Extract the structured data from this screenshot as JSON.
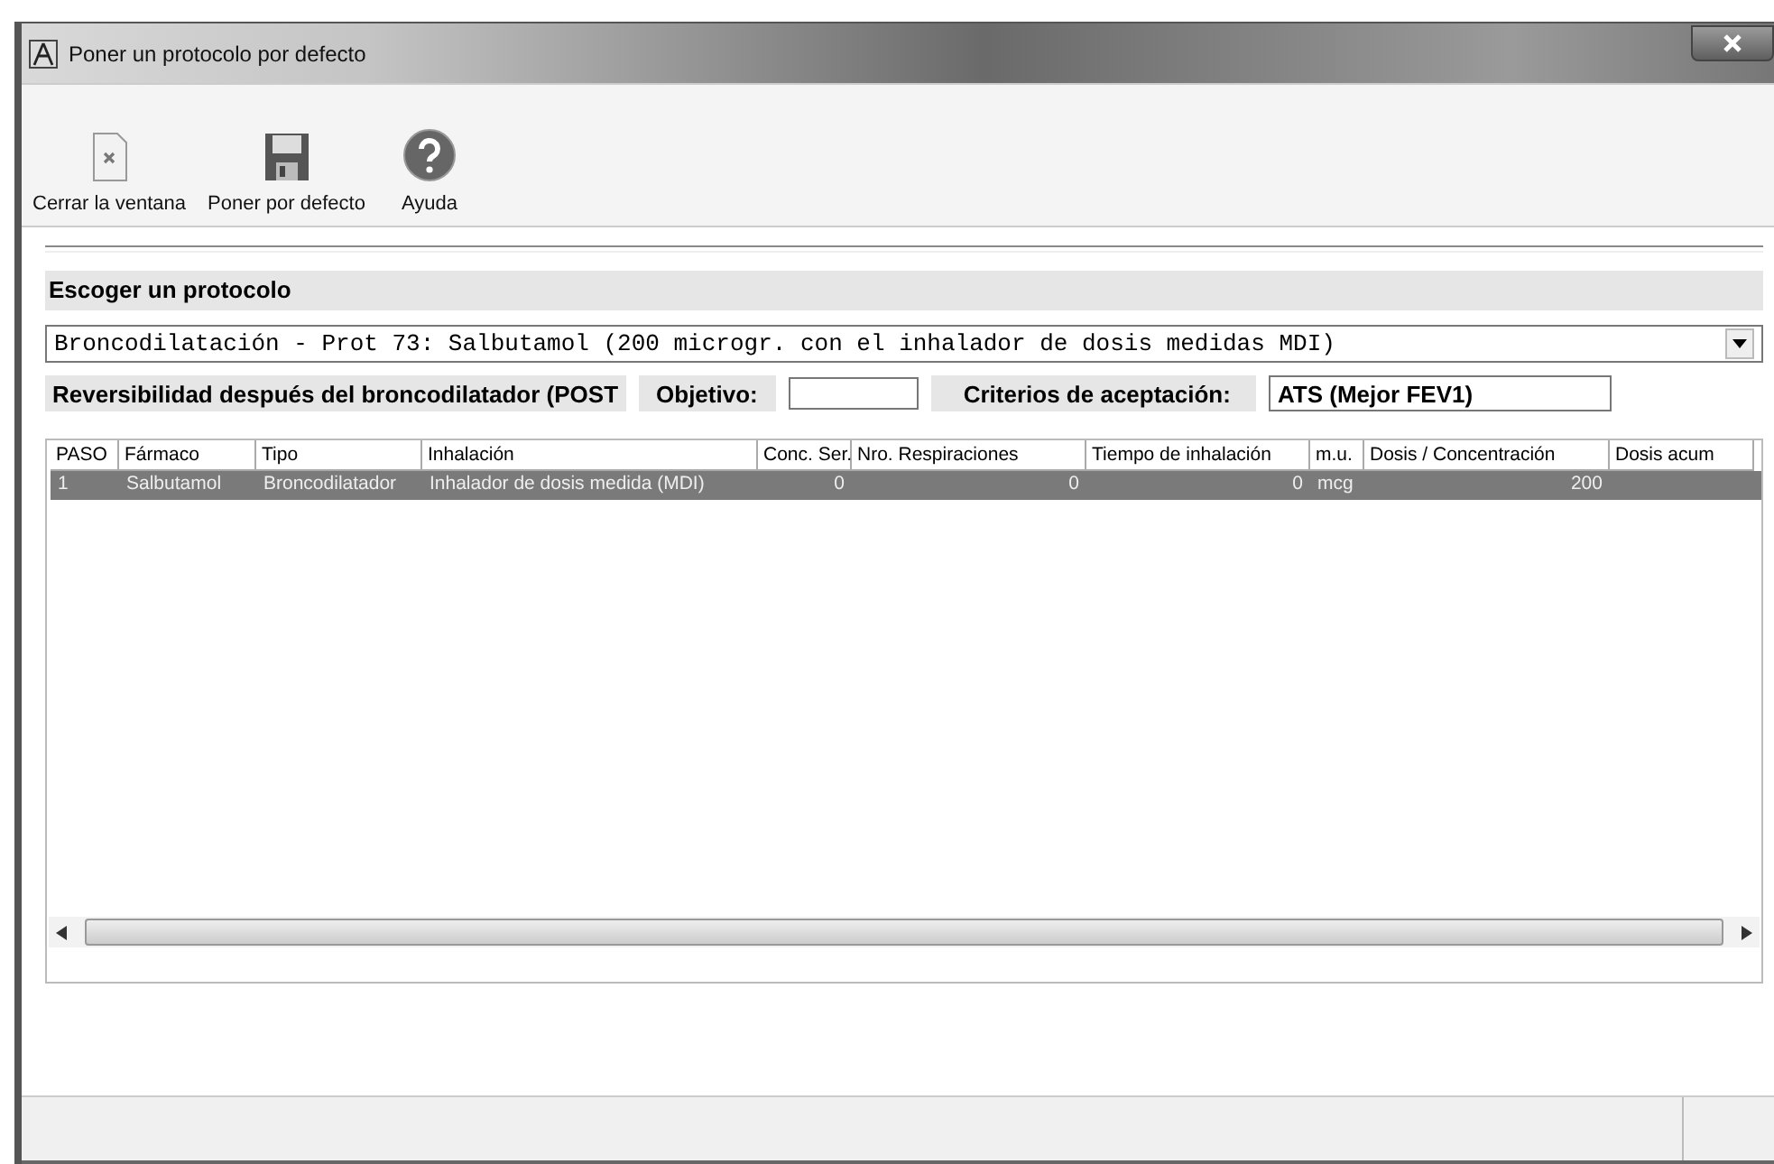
{
  "window": {
    "title": "Poner un protocolo por defecto"
  },
  "toolbar": [
    {
      "kind": "close",
      "label": "Cerrar la ventana"
    },
    {
      "kind": "save",
      "label": "Poner por defecto"
    },
    {
      "kind": "help",
      "label": "Ayuda"
    }
  ],
  "protocol_section": {
    "title": "Escoger un protocolo",
    "selected_protocol": "Broncodilatación - Prot 73: Salbutamol (200 microgr. con el inhalador de dosis medidas MDI)"
  },
  "reversibility": {
    "label": "Reversibilidad después del broncodilatador (POST",
    "objective_label": "Objetivo:",
    "acceptance_label": "Criterios de aceptación:",
    "acceptance_value": "ATS (Mejor FEV1)"
  },
  "table": {
    "columns": [
      "PASO",
      "Fármaco",
      "Tipo",
      "Inhalación",
      "Conc. Ser.",
      "Nro. Respiraciones",
      "Tiempo de inhalación",
      "m.u.",
      "Dosis / Concentración",
      "Dosis acum"
    ],
    "rows": [
      {
        "selected": true,
        "cells": [
          "1",
          "Salbutamol",
          "Broncodilatador",
          "Inhalador de dosis medida (MDI)",
          "0",
          "0",
          "0",
          "mcg",
          "200"
        ]
      }
    ]
  }
}
